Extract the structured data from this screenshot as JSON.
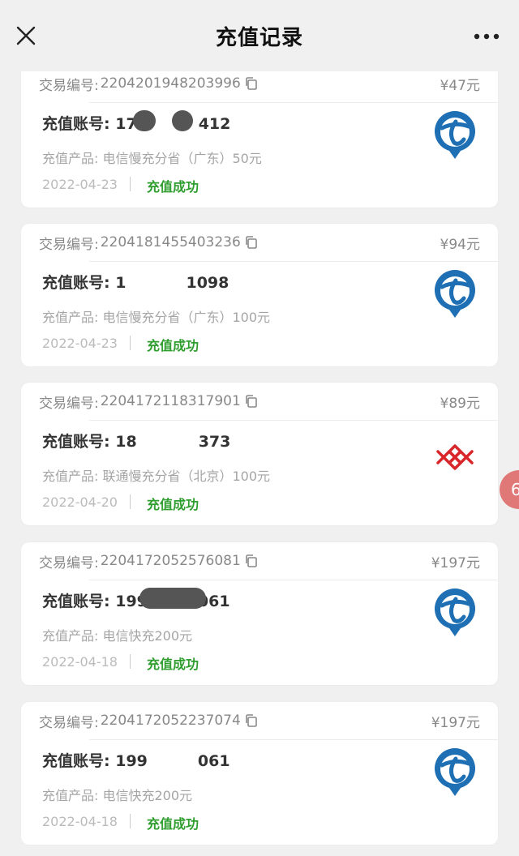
{
  "header": {
    "title": "充值记录"
  },
  "labels": {
    "order": "交易编号:",
    "account": "充值账号:"
  },
  "records": [
    {
      "order_no": "2204201948203996",
      "price": "¥47元",
      "account": "17■■■■■412",
      "acc_left": "17",
      "acc_right": "412",
      "product": "充值产品: 电信慢充分省（广东）50元",
      "date": "2022-04-23",
      "status": "充值成功",
      "carrier": "china-telecom"
    },
    {
      "order_no": "2204181455403236",
      "price": "¥94元",
      "account": "1■■■■■■1098",
      "acc_left": "1",
      "acc_right": "1098",
      "product": "充值产品: 电信慢充分省（广东）100元",
      "date": "2022-04-23",
      "status": "充值成功",
      "carrier": "china-telecom"
    },
    {
      "order_no": "2204172118317901",
      "price": "¥89元",
      "account": "18■■■■■373",
      "acc_left": "18",
      "acc_right": "373",
      "product": "充值产品: 联通慢充分省（北京）100元",
      "date": "2022-04-20",
      "status": "充值成功",
      "carrier": "china-unicom"
    },
    {
      "order_no": "2204172052576081",
      "price": "¥197元",
      "account": "199■■■■■061",
      "acc_left": "199",
      "acc_right": "061",
      "product": "充值产品: 电信快充200元",
      "date": "2022-04-18",
      "status": "充值成功",
      "carrier": "china-telecom"
    },
    {
      "order_no": "2204172052237074",
      "price": "¥197元",
      "account": "199■■■■■061",
      "acc_left": "199",
      "acc_right": "061",
      "product": "充值产品: 电信快充200元",
      "date": "2022-04-18",
      "status": "充值成功",
      "carrier": "china-telecom"
    }
  ],
  "float_badge": "6",
  "colors": {
    "success": "#2f9e2f",
    "telecom_blue": "#1e6fb4",
    "unicom_red": "#d8262b"
  }
}
